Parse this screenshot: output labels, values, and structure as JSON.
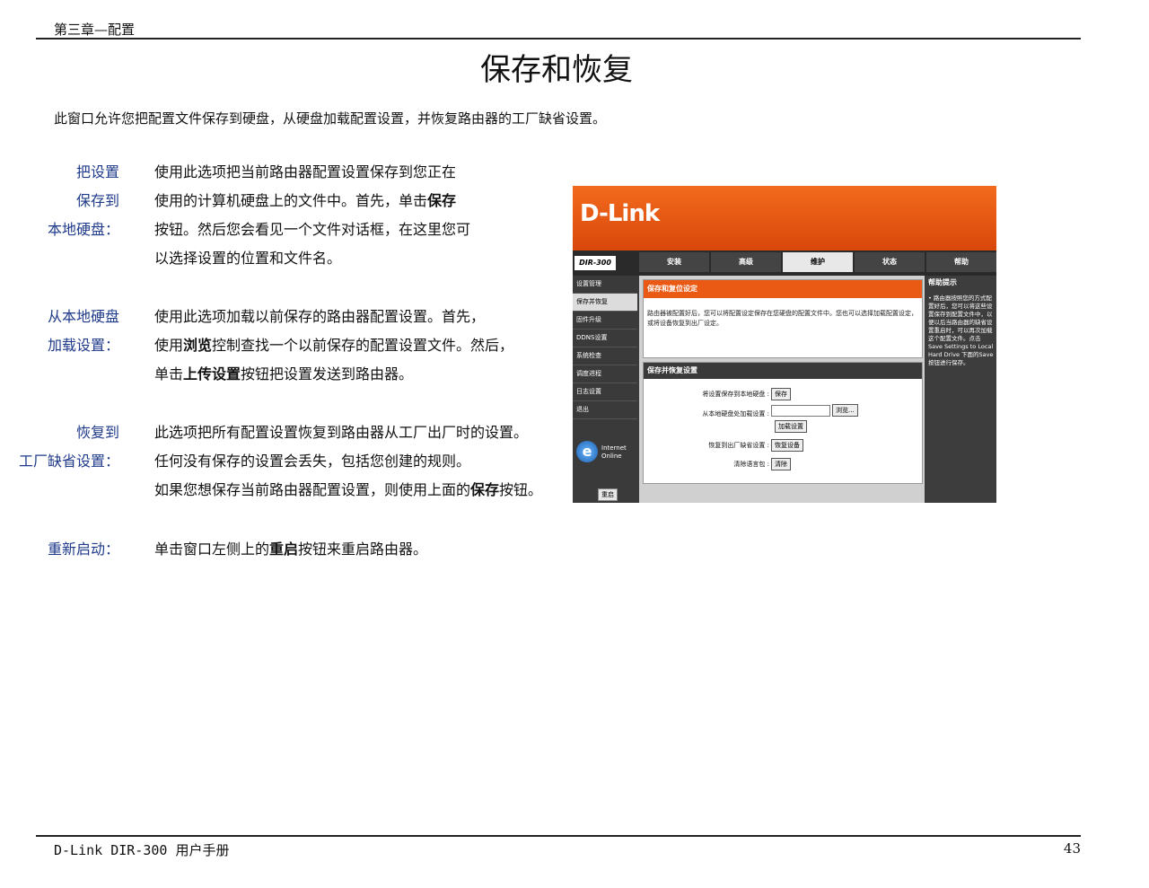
{
  "header": {
    "chapter": "第三章—配置",
    "title": "保存和恢复"
  },
  "intro": "此窗口允许您把配置文件保存到硬盘，从硬盘加载配置设置，并恢复路由器的工厂缺省设置。",
  "sections": [
    {
      "label_lines": [
        "把设置",
        "保存到",
        "本地硬盘："
      ],
      "text_lines": [
        [
          "使用此选项把当前路由器配置设置保存到您正在"
        ],
        [
          "使用的计算机硬盘上的文件中。首先，单击",
          "保存",
          ""
        ],
        [
          "按钮。然后您会看见一个文件对话框，在这里您可"
        ],
        [
          "以选择设置的位置和文件名。"
        ]
      ]
    },
    {
      "label_lines": [
        "从本地硬盘",
        "加载设置："
      ],
      "text_lines": [
        [
          "使用此选项加载以前保存的路由器配置设置。首先，"
        ],
        [
          "使用",
          "浏览",
          "控制查找一个以前保存的配置设置文件。然后，"
        ],
        [
          "单击",
          "上传设置",
          "按钮把设置发送到路由器。"
        ]
      ]
    },
    {
      "label_lines": [
        "恢复到",
        "工厂缺省设置："
      ],
      "text_lines": [
        [
          "此选项把所有配置设置恢复到路由器从工厂出厂时的设置。"
        ],
        [
          "任何没有保存的设置会丢失，包括您创建的规则。"
        ],
        [
          "如果您想保存当前路由器配置设置，则使用上面的",
          "保存",
          "按钮。"
        ]
      ]
    },
    {
      "label_lines": [
        "重新启动："
      ],
      "text_lines": [
        [
          "单击窗口左侧上的",
          "重启",
          "按钮来重启路由器。"
        ]
      ]
    }
  ],
  "footer": {
    "left": "D-Link DIR-300 用户手册",
    "page": "43"
  },
  "screenshot": {
    "logo": "D-Link",
    "model": "DIR-300",
    "tabs": [
      "安装",
      "高级",
      "维护",
      "状态",
      "帮助"
    ],
    "active_tab": "维护",
    "menu": [
      "设置管理",
      "保存并恢复",
      "固件升级",
      "DDNS设置",
      "系统检查",
      "调度进程",
      "日志设置",
      "退出"
    ],
    "internet_label": "Internet Online",
    "reboot_button": "重启",
    "box1_title": "保存和复位设定",
    "box1_text": "路由器被配置好后，您可以将配置设定保存在您硬盘的配置文件中。您也可以选择加载配置设定，或将设备恢复到出厂设定。",
    "box2_title": "保存并恢复设置",
    "rows": [
      {
        "label": "将设置保存到本地硬盘 :",
        "button": "保存"
      },
      {
        "label": "从本地硬盘处加载设置 :",
        "browse": "浏览...",
        "button": "加载设置"
      },
      {
        "label": "恢复到出厂缺省设置 :",
        "button": "恢复设备"
      },
      {
        "label": "清除语言包 :",
        "button": "清除"
      }
    ],
    "help_title": "帮助提示",
    "help_text": "• 路由器按照您的方式配置好后，您可以将这些设置保存到配置文件中，以便以后当路由器的缺省设置重启时，可以再次加载这个配置文件。点击 Save Settings to Local Hard Drive 下面的Save按钮进行保存。"
  }
}
